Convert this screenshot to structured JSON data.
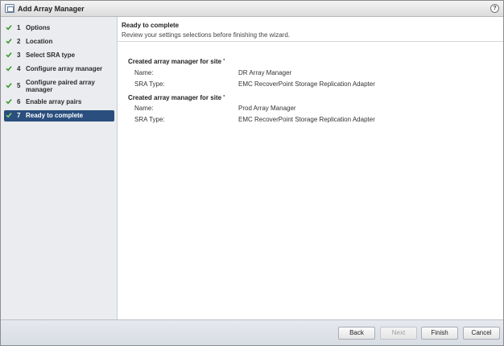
{
  "window": {
    "title": "Add Array Manager",
    "help_glyph": "?"
  },
  "steps": [
    {
      "num": "1",
      "label": "Options",
      "completed": true
    },
    {
      "num": "2",
      "label": "Location",
      "completed": true
    },
    {
      "num": "3",
      "label": "Select SRA type",
      "completed": true
    },
    {
      "num": "4",
      "label": "Configure array manager",
      "completed": true
    },
    {
      "num": "5",
      "label": "Configure paired array manager",
      "completed": true
    },
    {
      "num": "6",
      "label": "Enable array pairs",
      "completed": true
    },
    {
      "num": "7",
      "label": "Ready to complete",
      "completed": true,
      "active": true
    }
  ],
  "main": {
    "heading": "Ready to complete",
    "subheading": "Review your settings selections before finishing the wizard.",
    "sites": [
      {
        "title": "Created array manager for site '",
        "name_key": "Name:",
        "name_value": "DR Array Manager",
        "sra_key": "SRA Type:",
        "sra_value": "EMC RecoverPoint Storage Replication Adapter"
      },
      {
        "title": "Created array manager for site '",
        "name_key": "Name:",
        "name_value": "Prod Array Manager",
        "sra_key": "SRA Type:",
        "sra_value": "EMC RecoverPoint Storage Replication Adapter"
      }
    ]
  },
  "footer": {
    "back": "Back",
    "next": "Next",
    "finish": "Finish",
    "cancel": "Cancel"
  },
  "colors": {
    "active_step_bg": "#2a4f7e",
    "check_green": "#3a9a2a",
    "left_panel_bg": "#eaecef"
  }
}
